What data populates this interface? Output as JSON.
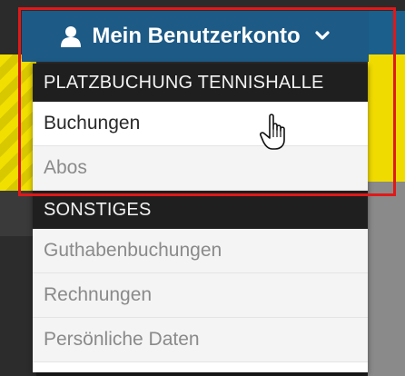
{
  "account_menu": {
    "toggle_label": "Mein Benutzerkonto",
    "toggle_icon": "user-icon",
    "toggle_chevron_icon": "chevron-down-icon",
    "sections": [
      {
        "header": "PLATZBUCHUNG TENNISHALLE",
        "items": [
          {
            "label": "Buchungen"
          },
          {
            "label": "Abos"
          }
        ]
      },
      {
        "header": "SONSTIGES",
        "items": [
          {
            "label": "Guthabenbuchungen"
          },
          {
            "label": "Rechnungen"
          },
          {
            "label": "Persönliche Daten"
          }
        ]
      }
    ]
  },
  "colors": {
    "toggle_bg": "#1d5a86",
    "section_header_bg": "#1f1f1f",
    "highlight_border": "#e01818",
    "item_text": "#2a2a2a",
    "item_text_muted": "#8a8a8a"
  },
  "cursor_icon": "hand-pointer-cursor"
}
